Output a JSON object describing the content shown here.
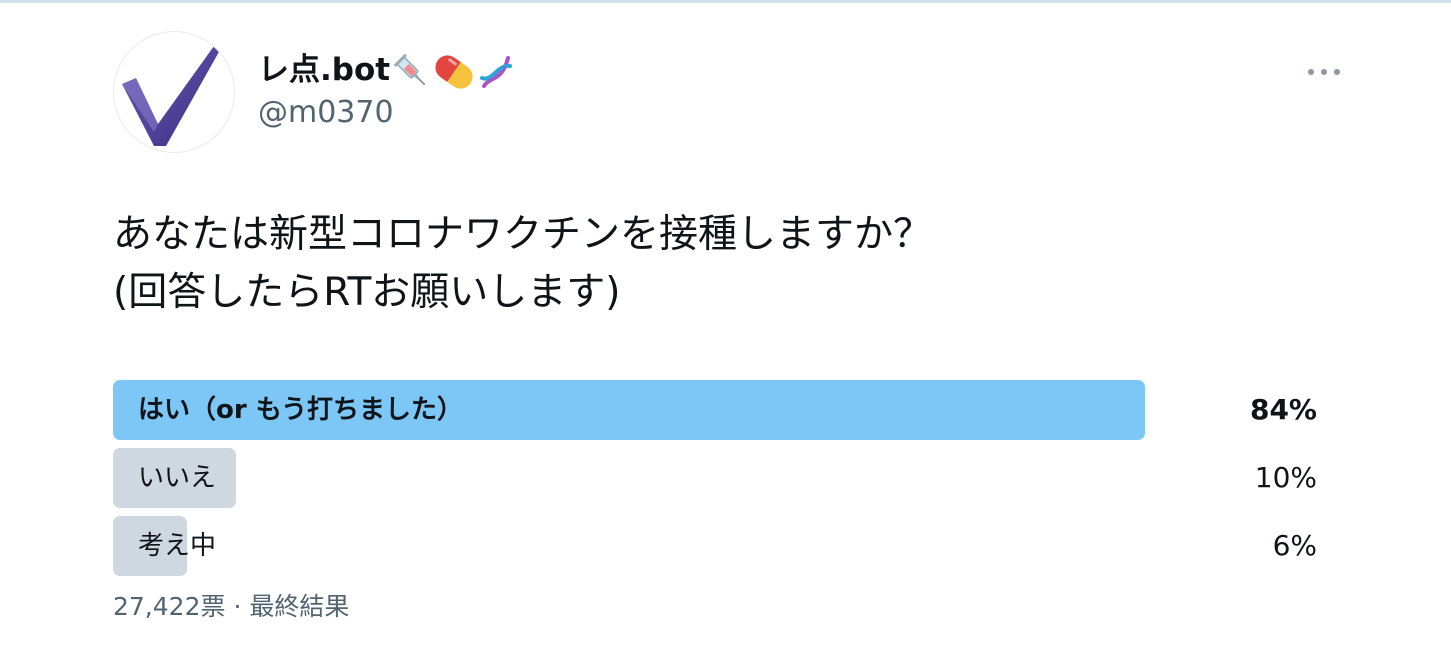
{
  "author": {
    "display_name": "レ点.bot",
    "handle": "@m0370",
    "avatar_icon": "checkmark-avatar",
    "name_emojis": [
      "syringe-icon",
      "pill-icon",
      "dna-icon"
    ]
  },
  "tweet": {
    "line1": "あなたは新型コロナワクチンを接種しますか？",
    "line2": "(回答したらRTお願いします)"
  },
  "poll": {
    "options": [
      {
        "label": "はい（or もう打ちました）",
        "percent": "84%",
        "share": 84,
        "winner": true
      },
      {
        "label": "いいえ",
        "percent": "10%",
        "share": 10,
        "winner": false
      },
      {
        "label": "考え中",
        "percent": "6%",
        "share": 6,
        "winner": false
      }
    ],
    "votes": "27,422票",
    "separator": "·",
    "status": "最終結果"
  },
  "colors": {
    "winner_bar": "#7cc7f6",
    "other_bar": "#cfd8e1",
    "secondary_text": "#536471",
    "primary_text": "#0f1419"
  }
}
